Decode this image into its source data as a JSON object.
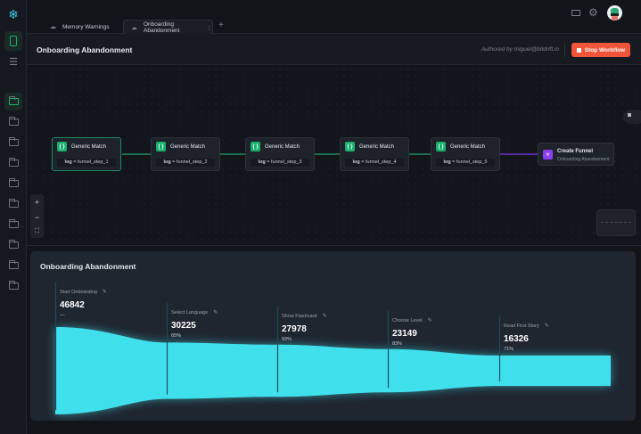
{
  "tabs": [
    {
      "label": "Memory Warnings",
      "active": false
    },
    {
      "label": "Onboarding Abandonment",
      "active": true
    }
  ],
  "header": {
    "title": "Onboarding Abandonment",
    "author": "Authored by miguel@bitdrift.io",
    "stop_label": "Stop Workflow"
  },
  "colors": {
    "accent": "#18b06d",
    "stop": "#f0553a",
    "funnel": "#3fe0ec",
    "funnel_node": "#8a3ff0"
  },
  "nodes": [
    {
      "title": "Generic Match",
      "key": "log",
      "value": "funnel_step_1"
    },
    {
      "title": "Generic Match",
      "key": "log",
      "value": "funnel_step_2"
    },
    {
      "title": "Generic Match",
      "key": "log",
      "value": "funnel_step_3"
    },
    {
      "title": "Generic Match",
      "key": "log",
      "value": "funnel_step_4"
    },
    {
      "title": "Generic Match",
      "key": "log",
      "value": "funnel_step_5"
    }
  ],
  "funnel_node": {
    "title": "Create Funnel",
    "subtitle": "Onboarding Abandonment"
  },
  "zoom": {
    "in": "+",
    "out": "−",
    "fit": "⛶"
  },
  "chart_data": {
    "type": "funnel",
    "title": "Onboarding Abandonment",
    "categories": [
      "Start Onboarding",
      "Select Language",
      "Show Flashcard",
      "Choose Level",
      "Read First Story"
    ],
    "values": [
      46842,
      30225,
      27978,
      23149,
      16326
    ],
    "conversion": [
      "—",
      "65%",
      "93%",
      "83%",
      "71%"
    ]
  }
}
